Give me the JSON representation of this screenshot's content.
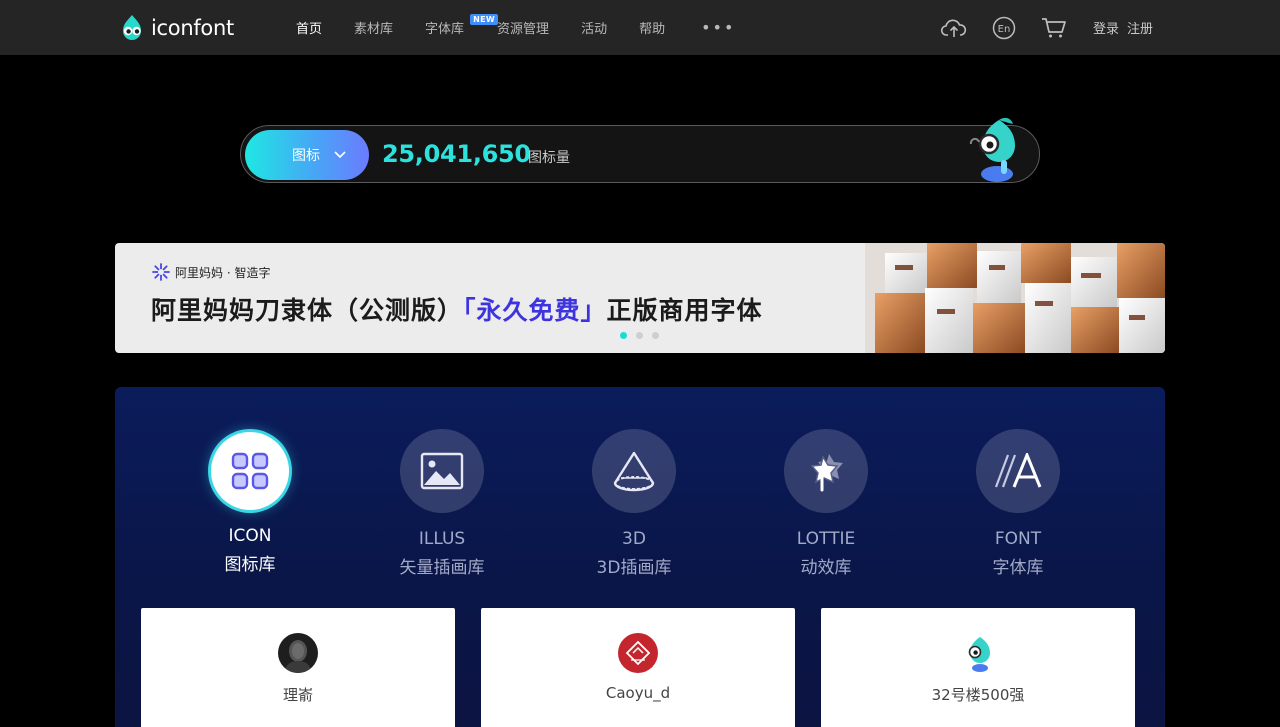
{
  "header": {
    "logo_text": "iconfont",
    "nav": [
      {
        "label": "首页",
        "active": true
      },
      {
        "label": "素材库"
      },
      {
        "label": "字体库",
        "badge": "NEW"
      },
      {
        "label": "资源管理"
      },
      {
        "label": "活动"
      },
      {
        "label": "帮助"
      }
    ],
    "more": "•••",
    "lang_label": "En",
    "login_label": "登录",
    "register_label": "注册"
  },
  "search": {
    "type_label": "图标",
    "count": "25,041,650",
    "count_unit": "图标量"
  },
  "banner": {
    "brand": "阿里妈妈 · 智造字",
    "title_prefix": "阿里妈妈刀隶体（公测版）",
    "title_highlight": "「永久免费」",
    "title_suffix": "正版商用字体",
    "active_slide": 1,
    "slides": 3
  },
  "categories": [
    {
      "en": "ICON",
      "cn": "图标库",
      "icon": "grid-icon",
      "active": true
    },
    {
      "en": "ILLUS",
      "cn": "矢量插画库",
      "icon": "picture-icon"
    },
    {
      "en": "3D",
      "cn": "3D插画库",
      "icon": "cone-icon"
    },
    {
      "en": "LOTTIE",
      "cn": "动效库",
      "icon": "star-motion-icon"
    },
    {
      "en": "FONT",
      "cn": "字体库",
      "icon": "font-a-icon"
    }
  ],
  "cards": [
    {
      "name": "理嵛"
    },
    {
      "name": "Caoyu_d"
    },
    {
      "name": "32号楼500强"
    }
  ],
  "colors": {
    "accent": "#1ed9d6",
    "topbar": "#252525",
    "panel": "#0b1c5c",
    "highlight": "#3d34e0"
  }
}
